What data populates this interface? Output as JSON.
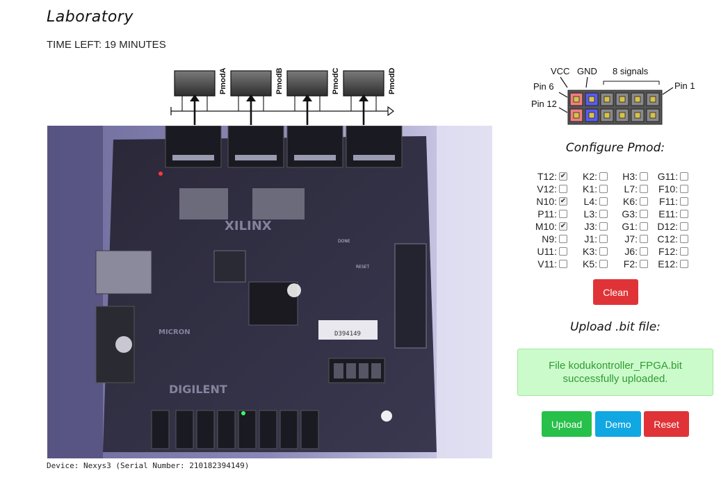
{
  "page": {
    "title": "Laboratory",
    "time_left": "TIME LEFT: 19 MINUTES",
    "device_info": "Device: Nexys3 (Serial Number: 210182394149)"
  },
  "pmod_ports": [
    "PmodA",
    "PmodB",
    "PmodC",
    "PmodD"
  ],
  "pinout": {
    "vcc": "VCC",
    "gnd": "GND",
    "signals": "8 signals",
    "pin6": "Pin 6",
    "pin12": "Pin 12",
    "pin1": "Pin 1"
  },
  "configure": {
    "heading": "Configure Pmod:",
    "columns": [
      [
        {
          "label": "T12:",
          "checked": true
        },
        {
          "label": "V12:",
          "checked": false
        },
        {
          "label": "N10:",
          "checked": true
        },
        {
          "label": "P11:",
          "checked": false
        },
        {
          "label": "M10:",
          "checked": true
        },
        {
          "label": "N9:",
          "checked": false
        },
        {
          "label": "U11:",
          "checked": false
        },
        {
          "label": "V11:",
          "checked": false
        }
      ],
      [
        {
          "label": "K2:",
          "checked": false
        },
        {
          "label": "K1:",
          "checked": false
        },
        {
          "label": "L4:",
          "checked": false
        },
        {
          "label": "L3:",
          "checked": false
        },
        {
          "label": "J3:",
          "checked": false
        },
        {
          "label": "J1:",
          "checked": false
        },
        {
          "label": "K3:",
          "checked": false
        },
        {
          "label": "K5:",
          "checked": false
        }
      ],
      [
        {
          "label": "H3:",
          "checked": false
        },
        {
          "label": "L7:",
          "checked": false
        },
        {
          "label": "K6:",
          "checked": false
        },
        {
          "label": "G3:",
          "checked": false
        },
        {
          "label": "G1:",
          "checked": false
        },
        {
          "label": "J7:",
          "checked": false
        },
        {
          "label": "J6:",
          "checked": false
        },
        {
          "label": "F2:",
          "checked": false
        }
      ],
      [
        {
          "label": "G11:",
          "checked": false
        },
        {
          "label": "F10:",
          "checked": false
        },
        {
          "label": "F11:",
          "checked": false
        },
        {
          "label": "E11:",
          "checked": false
        },
        {
          "label": "D12:",
          "checked": false
        },
        {
          "label": "C12:",
          "checked": false
        },
        {
          "label": "F12:",
          "checked": false
        },
        {
          "label": "E12:",
          "checked": false
        }
      ]
    ],
    "clean_label": "Clean"
  },
  "upload": {
    "heading": "Upload .bit file:",
    "status": "File kodukontroller_FPGA.bit successfully uploaded.",
    "upload_label": "Upload",
    "demo_label": "Demo",
    "reset_label": "Reset"
  },
  "board": {
    "brand_xilinx": "XILINX",
    "brand_digilent": "DIGILENT",
    "brand_micron": "MICRON",
    "barcode": "D394149",
    "label_done": "DONE",
    "label_reset": "RESET"
  },
  "colors": {
    "clean": "#e03337",
    "upload": "#27c04a",
    "demo": "#11a7e3",
    "reset": "#e03337",
    "alert_bg": "#ccfbcb",
    "alert_text": "#2f9b33"
  }
}
